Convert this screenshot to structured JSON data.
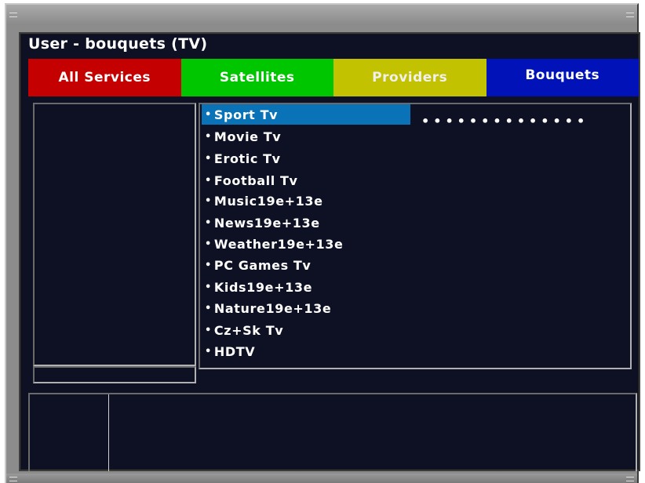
{
  "screen": {
    "title": "User - bouquets (TV)"
  },
  "tabs": [
    {
      "label": "All Services",
      "color": "#c40000"
    },
    {
      "label": "Satellites",
      "color": "#00c600"
    },
    {
      "label": "Providers",
      "color": "#c2c200"
    },
    {
      "label": "Bouquets",
      "color": "#0012b8"
    }
  ],
  "bouquet_list": {
    "bullet": "•",
    "selected_index": 0,
    "progress_dots": "••••••••••••••",
    "items": [
      "Sport Tv",
      "Movie Tv",
      "Erotic Tv",
      "Football Tv",
      "Music19e+13e",
      "News19e+13e",
      "Weather19e+13e",
      "PC Games Tv",
      "Kids19e+13e",
      "Nature19e+13e",
      "Cz+Sk Tv",
      "HDTV"
    ]
  },
  "colors": {
    "background": "#0e1124",
    "selection": "#0a73b8"
  }
}
